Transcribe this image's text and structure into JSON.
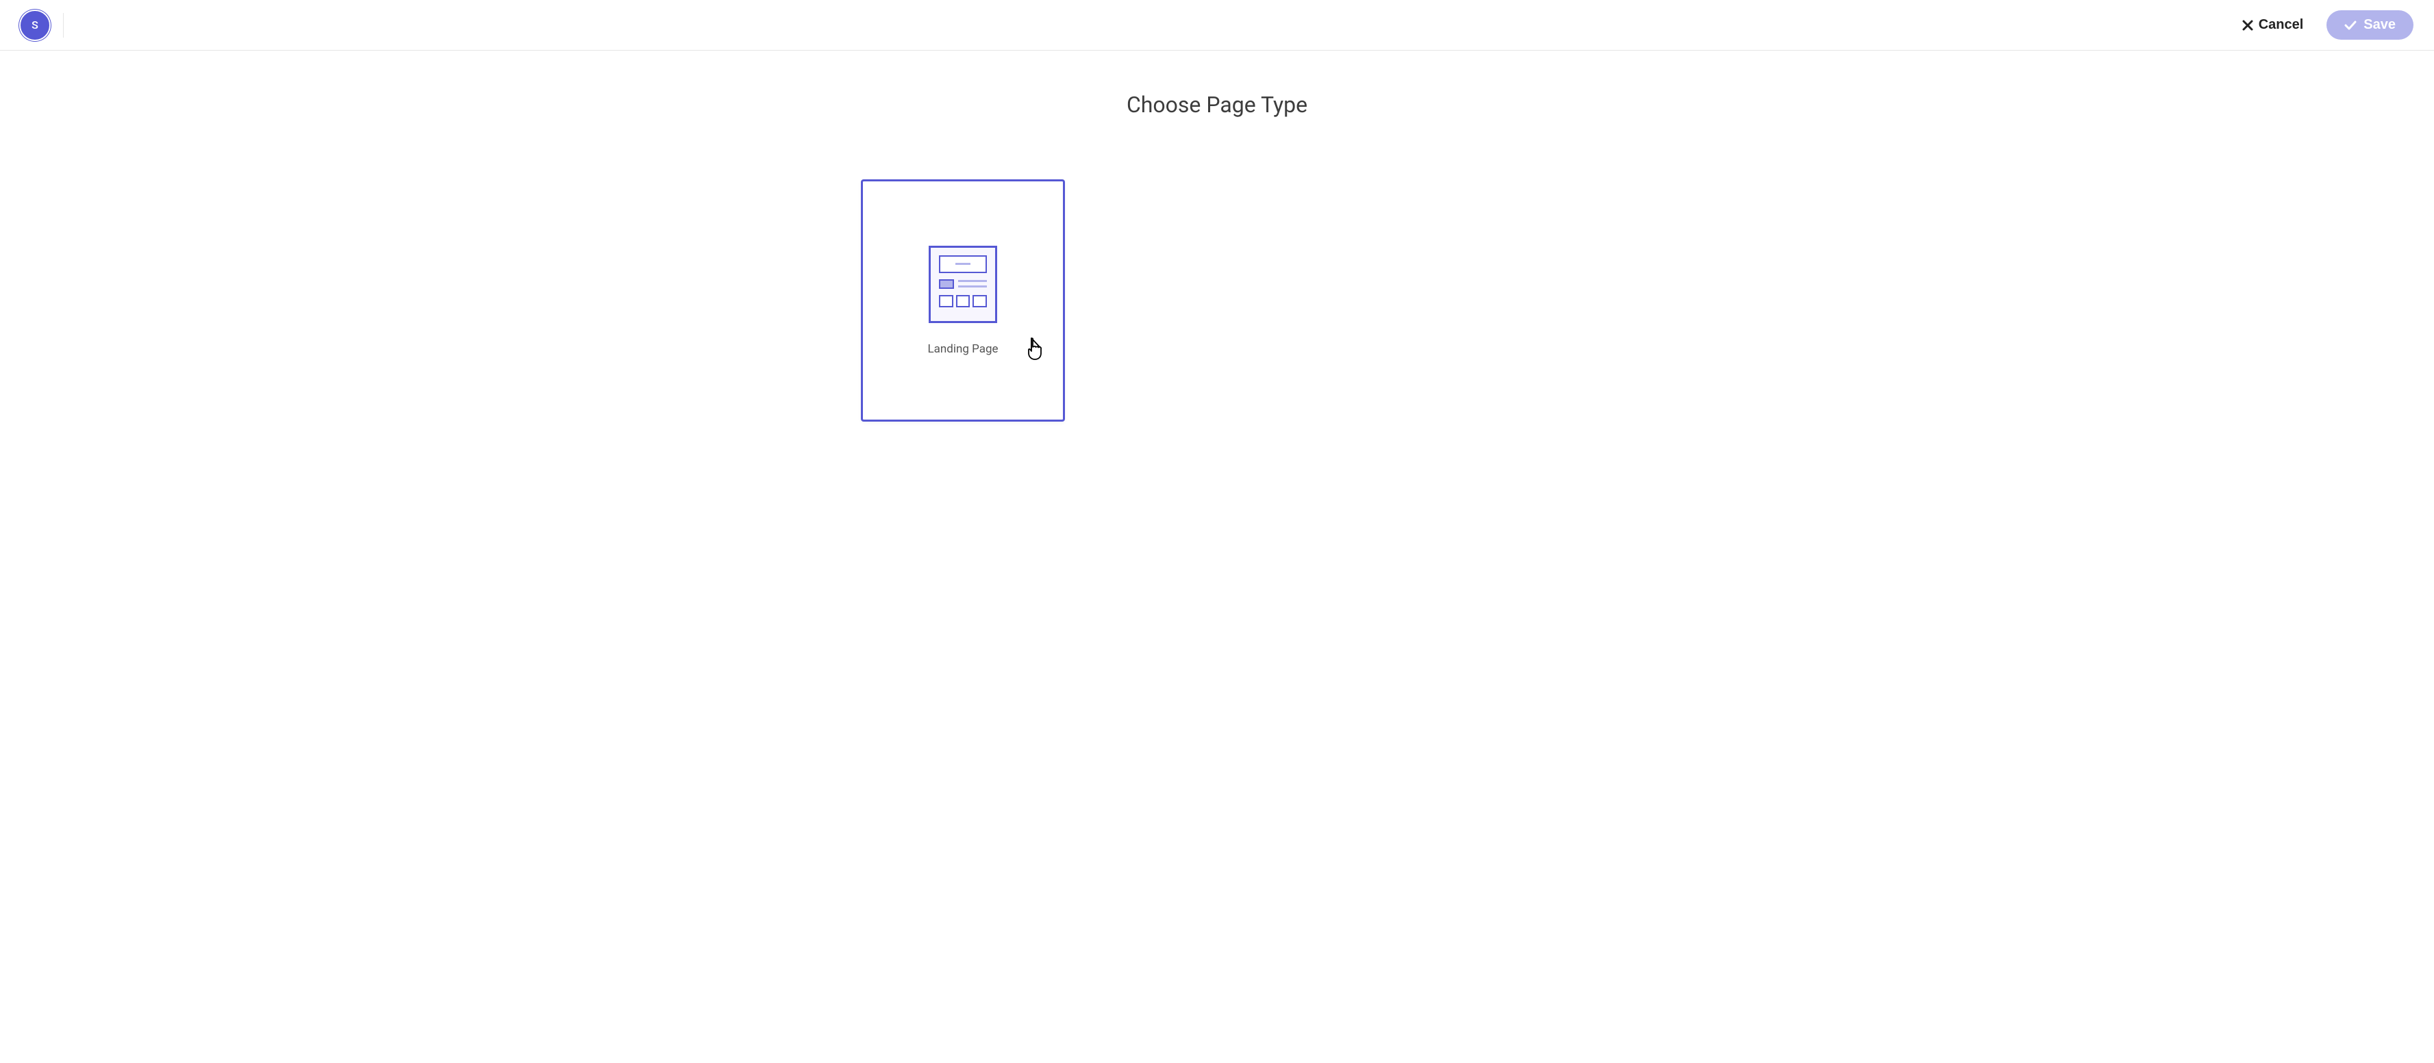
{
  "header": {
    "avatar_letter": "S",
    "cancel_label": "Cancel",
    "save_label": "Save"
  },
  "main": {
    "title": "Choose Page Type",
    "cards": [
      {
        "label": "Landing Page"
      }
    ]
  },
  "colors": {
    "accent": "#5558d4",
    "accent_light": "#b2b4ec"
  }
}
